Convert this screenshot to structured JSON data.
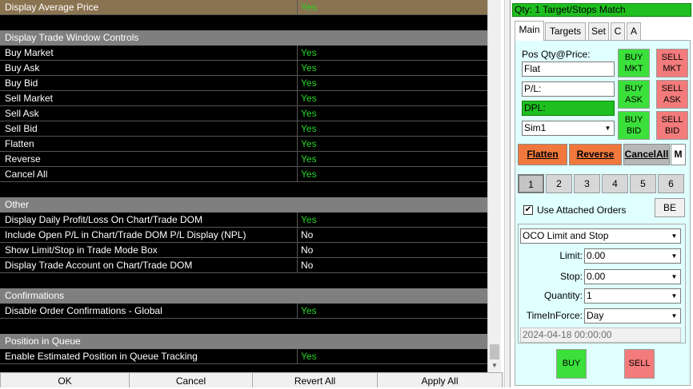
{
  "settings": {
    "rows": [
      {
        "kind": "item",
        "name": "Display Average Price",
        "value": "Yes",
        "selected": true
      },
      {
        "kind": "spacer"
      },
      {
        "kind": "header",
        "name": "Display Trade Window Controls"
      },
      {
        "kind": "item",
        "name": "Buy Market",
        "value": "Yes"
      },
      {
        "kind": "item",
        "name": "Buy Ask",
        "value": "Yes"
      },
      {
        "kind": "item",
        "name": "Buy Bid",
        "value": "Yes"
      },
      {
        "kind": "item",
        "name": "Sell Market",
        "value": "Yes"
      },
      {
        "kind": "item",
        "name": "Sell Ask",
        "value": "Yes"
      },
      {
        "kind": "item",
        "name": "Sell Bid",
        "value": "Yes"
      },
      {
        "kind": "item",
        "name": "Flatten",
        "value": "Yes"
      },
      {
        "kind": "item",
        "name": "Reverse",
        "value": "Yes"
      },
      {
        "kind": "item",
        "name": "Cancel All",
        "value": "Yes"
      },
      {
        "kind": "spacer"
      },
      {
        "kind": "header",
        "name": "Other"
      },
      {
        "kind": "item",
        "name": "Display Daily Profit/Loss On Chart/Trade DOM",
        "value": "Yes"
      },
      {
        "kind": "item",
        "name": "Include Open P/L in Chart/Trade DOM P/L Display (NPL)",
        "value": "No"
      },
      {
        "kind": "item",
        "name": "Show Limit/Stop in Trade Mode Box",
        "value": "No"
      },
      {
        "kind": "item",
        "name": "Display Trade Account on Chart/Trade DOM",
        "value": "No"
      },
      {
        "kind": "spacer"
      },
      {
        "kind": "header",
        "name": "Confirmations"
      },
      {
        "kind": "item",
        "name": "Disable Order Confirmations - Global",
        "value": "Yes"
      },
      {
        "kind": "spacer"
      },
      {
        "kind": "header",
        "name": "Position in Queue"
      },
      {
        "kind": "item",
        "name": "Enable Estimated Position in Queue Tracking",
        "value": "Yes"
      },
      {
        "kind": "spacer"
      }
    ]
  },
  "bottom_buttons": {
    "ok": "OK",
    "cancel": "Cancel",
    "revert": "Revert All",
    "apply": "Apply All"
  },
  "trade_panel": {
    "status": "Qty: 1 Target/Stops Match",
    "status_color": "#1fbf1f",
    "tabs": [
      "Main",
      "Targets",
      "Set",
      "C",
      "A"
    ],
    "active_tab": "Main",
    "pos_label": "Pos Qty@Price:",
    "pos_value": "Flat",
    "pl_value": "P/L:",
    "dpl_value": "DPL:",
    "account": "Sim1",
    "buttons": {
      "buy_mkt": "BUY\nMKT",
      "sell_mkt": "SELL\nMKT",
      "buy_ask": "BUY\nASK",
      "sell_ask": "SELL\nASK",
      "buy_bid": "BUY\nBID",
      "sell_bid": "SELL\nBID"
    },
    "flatten": "Flatten",
    "reverse": "Reverse",
    "cancel_all": "CancelAll",
    "m": "M",
    "quantity_buttons": [
      "1",
      "2",
      "3",
      "4",
      "5",
      "6"
    ],
    "selected_quantity": "1",
    "use_attached_orders": "Use Attached Orders",
    "use_attached_checked": true,
    "be": "BE",
    "order_type": "OCO Limit and Stop",
    "limit_label": "Limit:",
    "limit_value": "0.00",
    "stop_label": "Stop:",
    "stop_value": "0.00",
    "quantity_label": "Quantity:",
    "quantity_value": "1",
    "tif_label": "TimeInForce:",
    "tif_value": "Day",
    "datetime": "2024-04-18  00:00:00",
    "buy": "BUY",
    "sell": "SELL",
    "buy_color": "#3be03b",
    "sell_color": "#f37b7b",
    "action_color": "#f0783c"
  }
}
